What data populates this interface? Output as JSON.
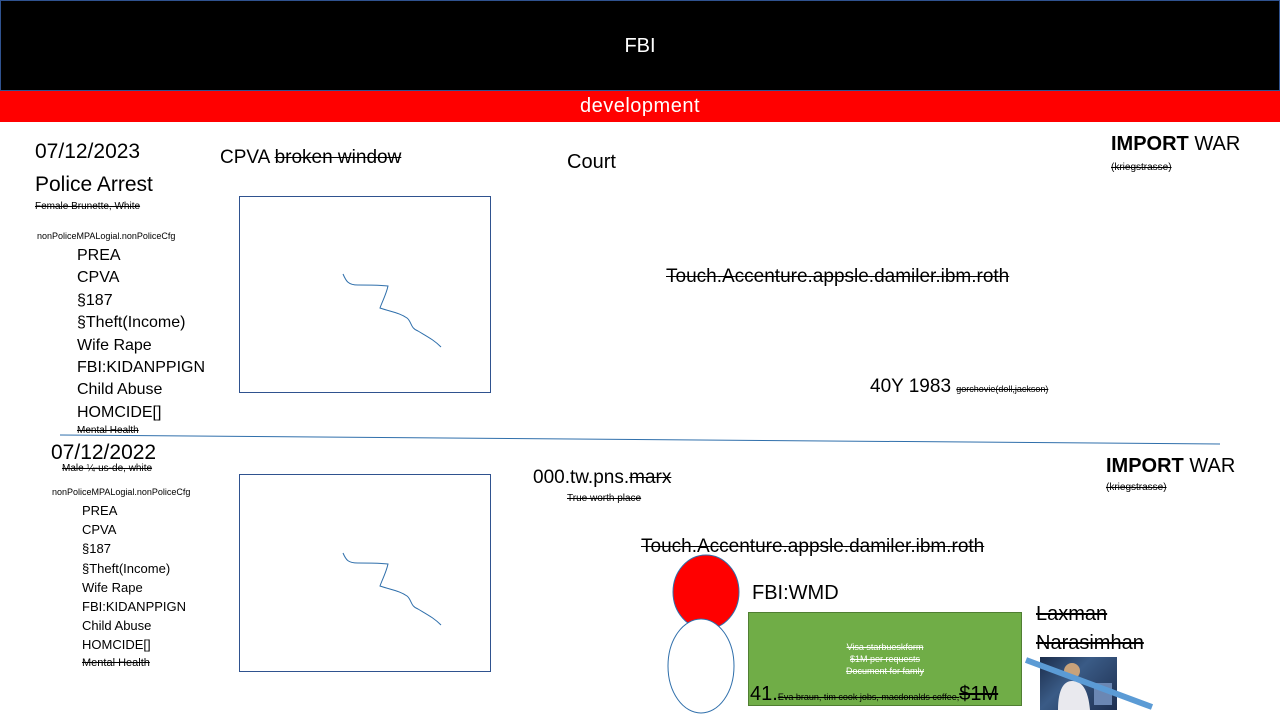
{
  "header": {
    "title": "FBI"
  },
  "band": {
    "label": "development"
  },
  "top": {
    "date": "07/12/2023",
    "heading": "Police Arrest",
    "subject": "Female Brunette,  White",
    "code": "nonPoliceMPALogial.nonPoliceCfg",
    "items": [
      "PREA",
      "CPVA",
      "§187",
      "§Theft(Income)",
      "Wife Rape",
      "FBI:KIDANPPIGN",
      "Child Abuse",
      "HOMCIDE[]"
    ],
    "footer_item": "Mental Health",
    "cpva_label": "CPVA",
    "cpva_strike": "broken window",
    "court": "Court",
    "touch": "Touch.Accenture.appsle.damiler.ibm.roth",
    "year": "40Y 1983",
    "year_note": "gorchovie(doll,jackson)",
    "import_bold": "IMPORT",
    "import_rest": " WAR",
    "import_note": "(kriegstrasse)"
  },
  "bottom": {
    "date": "07/12/2022",
    "subject": "Male ¼-us-de, white",
    "code": "nonPoliceMPALogial.nonPoliceCfg",
    "items": [
      "PREA",
      "CPVA",
      "§187",
      "§Theft(Income)",
      "Wife Rape",
      "FBI:KIDANPPIGN",
      "Child Abuse",
      "HOMCIDE[]"
    ],
    "footer_item": "Mental Health",
    "tw_prefix": "000.tw.pns.",
    "tw_strike": "marx",
    "tw_note": "True worth place",
    "touch": "Touch.Accenture.appsle.damiler.ibm.roth",
    "wmd": "FBI:WMD",
    "green_lines": [
      "Visa starbueskform",
      "$1M per requests",
      "Document for famly"
    ],
    "num": "41.",
    "names": "Eva braun, tim cook  jobs, macdonalds coffee,",
    "amount": "$1M",
    "person_line1": "Laxman ",
    "person_line2": "Narasimhan",
    "import_bold": "IMPORT",
    "import_rest": " WAR",
    "import_note": "(kriegstrasse)"
  },
  "colors": {
    "header": "#000000",
    "band": "#ff0000",
    "green": "#70ad47",
    "red_circle": "#ff0000",
    "line": "#2f6fab",
    "slash": "#5b9bd5"
  }
}
